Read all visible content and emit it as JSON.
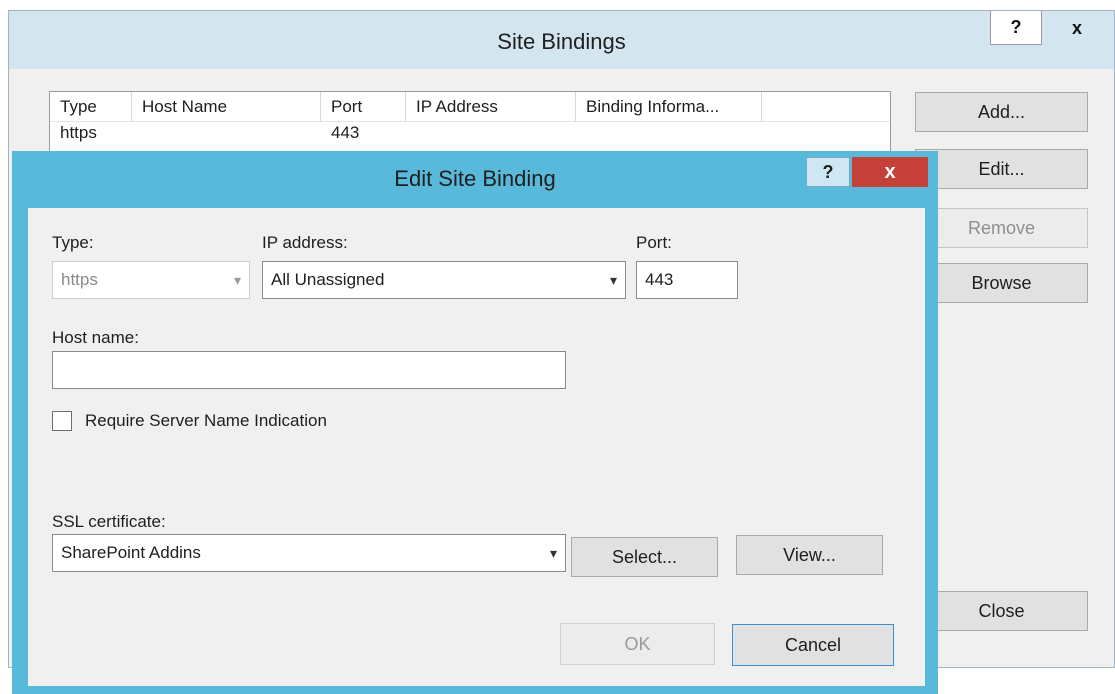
{
  "site_bindings": {
    "title": "Site Bindings",
    "help_label": "?",
    "close_label": "x",
    "columns": [
      "Type",
      "Host Name",
      "Port",
      "IP Address",
      "Binding Informa..."
    ],
    "rows": [
      {
        "type": "https",
        "host_name": "",
        "port": "443",
        "ip_address": "",
        "binding_info": ""
      }
    ],
    "buttons": {
      "add": "Add...",
      "edit": "Edit...",
      "remove": "Remove",
      "browse": "Browse",
      "close": "Close"
    }
  },
  "edit_binding": {
    "title": "Edit Site Binding",
    "help_label": "?",
    "close_label": "x",
    "type_label": "Type:",
    "type_value": "https",
    "ip_label": "IP address:",
    "ip_value": "All Unassigned",
    "port_label": "Port:",
    "port_value": "443",
    "host_label": "Host name:",
    "host_value": "",
    "sni_label": "Require Server Name Indication",
    "sni_checked": false,
    "ssl_label": "SSL certificate:",
    "ssl_value": "SharePoint Addins",
    "select_button": "Select...",
    "view_button": "View...",
    "ok_button": "OK",
    "cancel_button": "Cancel",
    "chevron": "▾"
  }
}
